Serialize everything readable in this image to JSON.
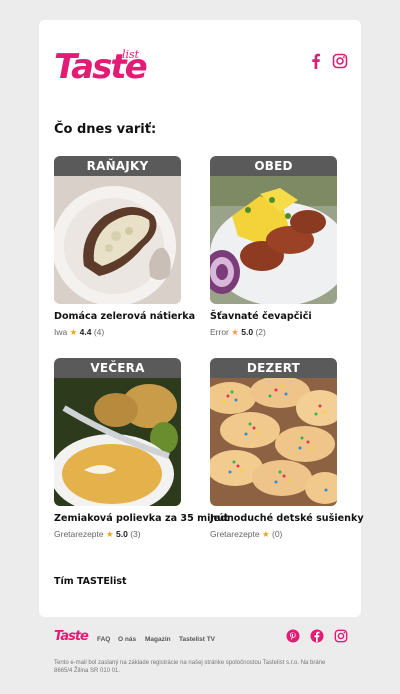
{
  "brand": {
    "logo_main": "Taste",
    "logo_sub": "list",
    "color": "#e31b74"
  },
  "header": {
    "social": [
      {
        "icon": "facebook-icon"
      },
      {
        "icon": "instagram-icon"
      }
    ]
  },
  "heading": "Čo dnes variť:",
  "recipes": [
    {
      "category": "RAŇAJKY",
      "title": "Domáca zelerová nátierka",
      "author": "Iwa",
      "rating": "4.4",
      "count": "(4)"
    },
    {
      "category": "OBED",
      "title": "Šťavnaté čevapčiči",
      "author": "Error",
      "rating": "5.0",
      "count": "(2)"
    },
    {
      "category": "VEČERA",
      "title": "Zemiaková polievka za 35 minút",
      "author": "Gretarezepte",
      "rating": "5.0",
      "count": "(3)"
    },
    {
      "category": "DEZERT",
      "title": "Jednoduché detské sušienky",
      "author": "Gretarezepte",
      "rating": "",
      "count": "(0)"
    }
  ],
  "signature": "Tím TASTElist",
  "footer": {
    "logo": "Taste",
    "nav": [
      "FAQ",
      "O nás",
      "Magazín",
      "Tastelist TV"
    ],
    "social": [
      {
        "icon": "pinterest-icon"
      },
      {
        "icon": "facebook-icon"
      },
      {
        "icon": "instagram-icon"
      }
    ],
    "fine_print": "Tento e-mail bol zaslaný na základe registrácie na našej stránke spoločnostou Tastelist s.r.o. Na bráne 8665/4 Žilina SR 010 01."
  },
  "star_glyph": "★"
}
